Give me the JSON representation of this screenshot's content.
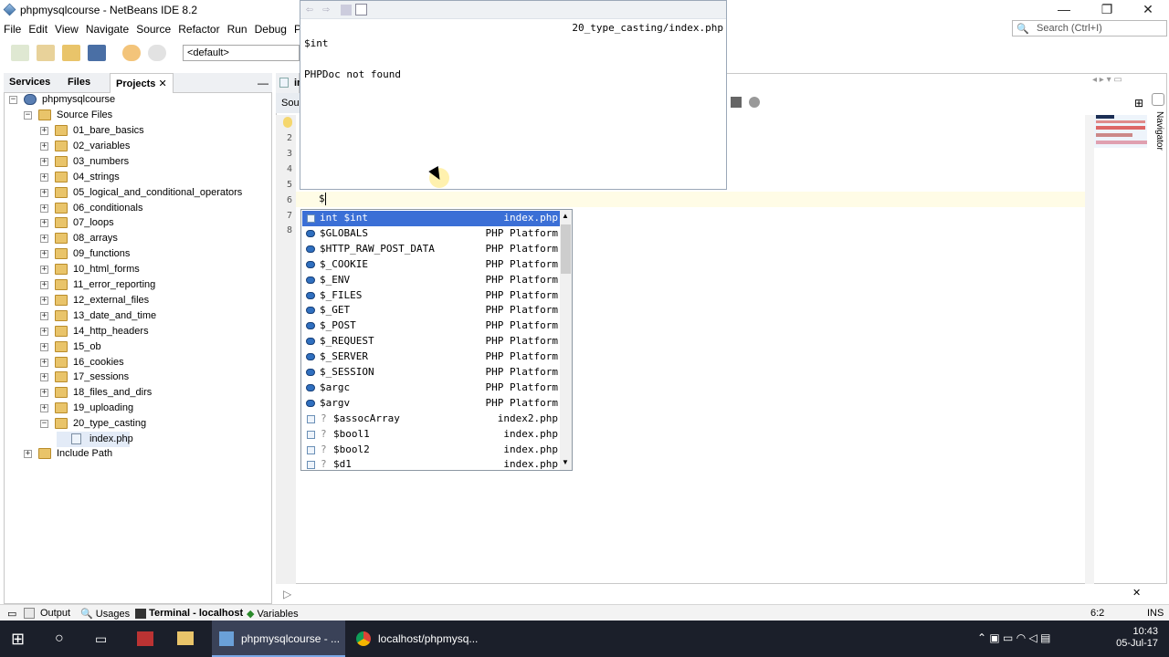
{
  "window": {
    "title": "phpmysqlcourse - NetBeans IDE 8.2"
  },
  "menu": [
    "File",
    "Edit",
    "View",
    "Navigate",
    "Source",
    "Refactor",
    "Run",
    "Debug",
    "Profile"
  ],
  "toolbar": {
    "config": "<default>"
  },
  "search": {
    "placeholder": "Search (Ctrl+I)"
  },
  "panel_tabs": [
    "Services",
    "Files",
    "Projects"
  ],
  "project": {
    "name": "phpmysqlcourse",
    "source_files": "Source Files",
    "folders": [
      "01_bare_basics",
      "02_variables",
      "03_numbers",
      "04_strings",
      "05_logical_and_conditional_operators",
      "06_conditionals",
      "07_loops",
      "08_arrays",
      "09_functions",
      "10_html_forms",
      "11_error_reporting",
      "12_external_files",
      "13_date_and_time",
      "14_http_headers",
      "15_ob",
      "16_cookies",
      "17_sessions",
      "18_files_and_dirs",
      "19_uploading",
      "20_type_casting"
    ],
    "open_file": "index.php",
    "include_path": "Include Path"
  },
  "editor": {
    "tab_label": "Sou",
    "tab_short": "ind",
    "line_numbers": [
      "2",
      "3",
      "4",
      "5",
      "6",
      "7",
      "8"
    ],
    "current_text": "$"
  },
  "doc_popup": {
    "path": "20_type_casting/index.php",
    "symbol": "$int",
    "message": "PHPDoc not found"
  },
  "completion": [
    {
      "name": "int $int",
      "source": "index.php",
      "kind": "var",
      "selected": true
    },
    {
      "name": "$GLOBALS",
      "source": "PHP Platform",
      "kind": "platform"
    },
    {
      "name": "$HTTP_RAW_POST_DATA",
      "source": "PHP Platform",
      "kind": "platform"
    },
    {
      "name": "$_COOKIE",
      "source": "PHP Platform",
      "kind": "platform"
    },
    {
      "name": "$_ENV",
      "source": "PHP Platform",
      "kind": "platform"
    },
    {
      "name": "$_FILES",
      "source": "PHP Platform",
      "kind": "platform"
    },
    {
      "name": "$_GET",
      "source": "PHP Platform",
      "kind": "platform"
    },
    {
      "name": "$_POST",
      "source": "PHP Platform",
      "kind": "platform"
    },
    {
      "name": "$_REQUEST",
      "source": "PHP Platform",
      "kind": "platform"
    },
    {
      "name": "$_SERVER",
      "source": "PHP Platform",
      "kind": "platform"
    },
    {
      "name": "$_SESSION",
      "source": "PHP Platform",
      "kind": "platform"
    },
    {
      "name": "$argc",
      "source": "PHP Platform",
      "kind": "platform"
    },
    {
      "name": "$argv",
      "source": "PHP Platform",
      "kind": "platform"
    },
    {
      "name": "$assocArray",
      "source": "index2.php",
      "kind": "unknown"
    },
    {
      "name": "$bool1",
      "source": "index.php",
      "kind": "unknown"
    },
    {
      "name": "$bool2",
      "source": "index.php",
      "kind": "unknown"
    },
    {
      "name": "$d1",
      "source": "index.php",
      "kind": "unknown"
    }
  ],
  "status": {
    "position": "6:2",
    "mode": "INS"
  },
  "bottom_tabs": [
    "Output",
    "Usages",
    "Terminal - localhost",
    "Variables"
  ],
  "taskbar": {
    "tasks": [
      "phpmysqlcourse - ...",
      "localhost/phpmysq..."
    ],
    "time": "10:43",
    "date": "05-Jul-17"
  },
  "navigator_label": "Navigator",
  "colors": {
    "selection": "#3b6fd6",
    "current_line": "#fffce6"
  }
}
